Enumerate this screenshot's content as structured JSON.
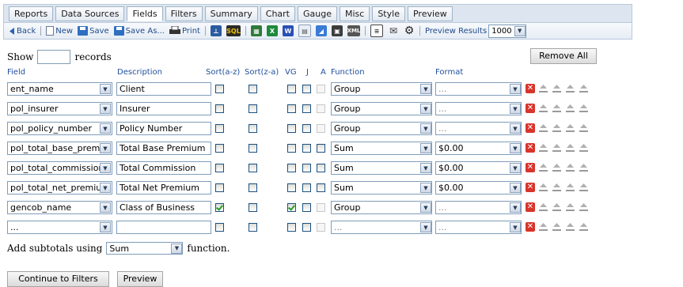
{
  "tabs": [
    "Reports",
    "Data Sources",
    "Fields",
    "Filters",
    "Summary",
    "Chart",
    "Gauge",
    "Misc",
    "Style",
    "Preview"
  ],
  "active_tab": "Fields",
  "toolbar": {
    "back": "Back",
    "new": "New",
    "save": "Save",
    "save_as": "Save As...",
    "print": "Print",
    "preview_results": "Preview Results",
    "preview_count": "1000"
  },
  "show": {
    "before": "Show",
    "after": "records",
    "value": ""
  },
  "remove_all": "Remove All",
  "headers": {
    "field": "Field",
    "description": "Description",
    "sort_az": "Sort(a-z)",
    "sort_za": "Sort(z-a)",
    "vg": "VG",
    "j": "J",
    "a": "A",
    "function": "Function",
    "format": "Format"
  },
  "rows": [
    {
      "field": "ent_name",
      "description": "Client",
      "sort_az": false,
      "sort_za": false,
      "vg": false,
      "j": false,
      "a": false,
      "a_enabled": false,
      "function": "Group",
      "format": "..."
    },
    {
      "field": "pol_insurer",
      "description": "Insurer",
      "sort_az": false,
      "sort_za": false,
      "vg": false,
      "j": false,
      "a": false,
      "a_enabled": false,
      "function": "Group",
      "format": "..."
    },
    {
      "field": "pol_policy_number",
      "description": "Policy Number",
      "sort_az": false,
      "sort_za": false,
      "vg": false,
      "j": false,
      "a": false,
      "a_enabled": false,
      "function": "Group",
      "format": "..."
    },
    {
      "field": "pol_total_base_premiu",
      "description": "Total Base Premium",
      "sort_az": false,
      "sort_za": false,
      "vg": false,
      "j": false,
      "a": false,
      "a_enabled": true,
      "function": "Sum",
      "format": "$0.00"
    },
    {
      "field": "pol_total_commission",
      "description": "Total Commission",
      "sort_az": false,
      "sort_za": false,
      "vg": false,
      "j": false,
      "a": false,
      "a_enabled": true,
      "function": "Sum",
      "format": "$0.00"
    },
    {
      "field": "pol_total_net_premiur",
      "description": "Total Net Premium",
      "sort_az": false,
      "sort_za": false,
      "vg": false,
      "j": false,
      "a": false,
      "a_enabled": true,
      "function": "Sum",
      "format": "$0.00"
    },
    {
      "field": "gencob_name",
      "description": "Class of Business",
      "sort_az": true,
      "sort_za": false,
      "vg": true,
      "j": false,
      "a": false,
      "a_enabled": false,
      "function": "Group",
      "format": "..."
    },
    {
      "field": "...",
      "description": "",
      "sort_az": false,
      "sort_za": false,
      "vg": false,
      "j": false,
      "a": false,
      "a_enabled": false,
      "function": "...",
      "format": "..."
    }
  ],
  "subtotals": {
    "before": "Add subtotals using",
    "value": "Sum",
    "after": "function."
  },
  "buttons": {
    "continue": "Continue to Filters",
    "preview": "Preview"
  }
}
